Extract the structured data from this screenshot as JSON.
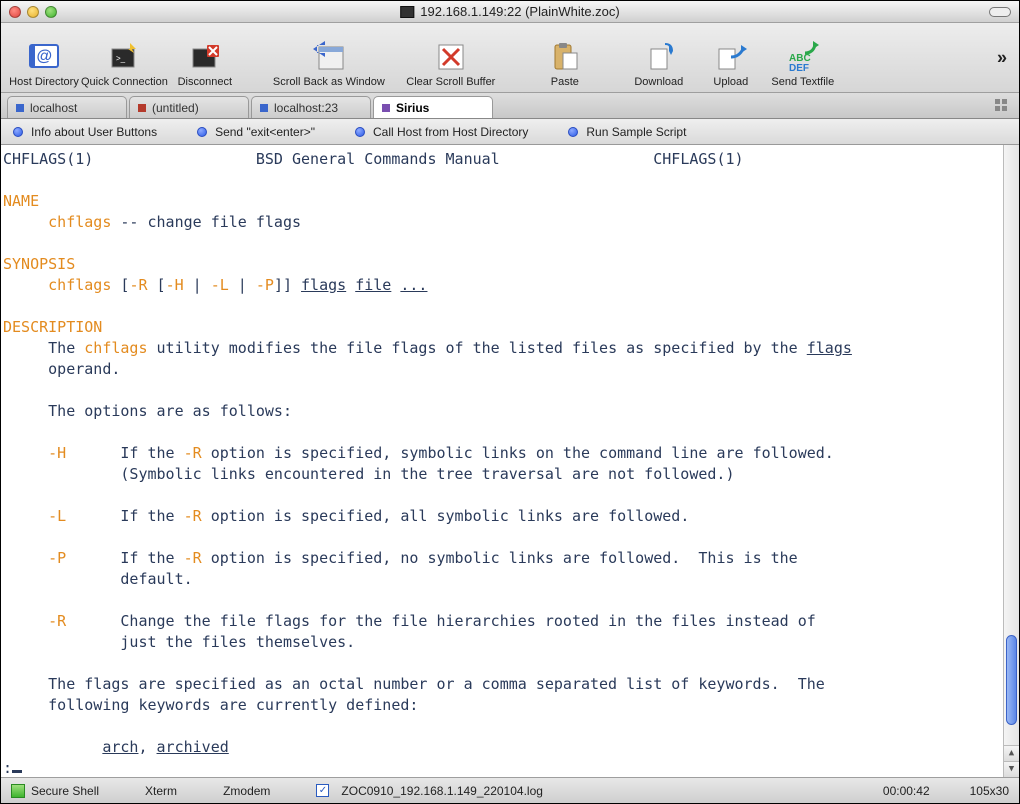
{
  "window": {
    "title": "192.168.1.149:22 (PlainWhite.zoc)"
  },
  "toolbar": [
    {
      "label": "Host Directory"
    },
    {
      "label": "Quick Connection"
    },
    {
      "label": "Disconnect"
    },
    {
      "label": "Scroll Back as Window"
    },
    {
      "label": "Clear Scroll Buffer"
    },
    {
      "label": "Paste"
    },
    {
      "label": "Download"
    },
    {
      "label": "Upload"
    },
    {
      "label": "Send Textfile"
    }
  ],
  "tabs": [
    {
      "label": "localhost",
      "color": "blue",
      "active": false
    },
    {
      "label": "(untitled)",
      "color": "red",
      "active": false
    },
    {
      "label": "localhost:23",
      "color": "blue",
      "active": false
    },
    {
      "label": "Sirius",
      "color": "purple",
      "active": true
    }
  ],
  "userButtons": [
    {
      "label": "Info about User Buttons"
    },
    {
      "label": "Send \"exit<enter>\""
    },
    {
      "label": "Call Host from Host Directory"
    },
    {
      "label": "Run Sample Script"
    }
  ],
  "terminal": {
    "header_left": "CHFLAGS(1)",
    "header_center": "BSD General Commands Manual",
    "header_right": "CHFLAGS(1)",
    "name_hdr": "NAME",
    "name_cmd": "chflags",
    "name_desc": " -- change file flags",
    "syn_hdr": "SYNOPSIS",
    "syn_cmd": "chflags",
    "syn_b1": " [",
    "syn_R": "-R",
    "syn_b2": " [",
    "syn_H": "-H",
    "syn_pipe1": " | ",
    "syn_L": "-L",
    "syn_pipe2": " | ",
    "syn_P": "-P",
    "syn_b3": "]] ",
    "syn_flags": "flags",
    "syn_sp": " ",
    "syn_file": "file",
    "syn_sp2": " ",
    "syn_dots": "...",
    "desc_hdr": "DESCRIPTION",
    "desc_pre": "     The ",
    "desc_cmd": "chflags",
    "desc_mid": " utility modifies the file flags of the listed files as specified by the ",
    "desc_flags": "flags",
    "desc_line2": "     operand.",
    "opts_intro": "     The options are as follows:",
    "optH_tag": "-H",
    "optH_pre": "      If the ",
    "optH_R": "-R",
    "optH_post": " option is specified, symbolic links on the command line are followed.",
    "optH_line2": "             (Symbolic links encountered in the tree traversal are not followed.)",
    "optL_tag": "-L",
    "optL_pre": "      If the ",
    "optL_R": "-R",
    "optL_post": " option is specified, all symbolic links are followed.",
    "optP_tag": "-P",
    "optP_pre": "      If the ",
    "optP_R": "-R",
    "optP_post": " option is specified, no symbolic links are followed.  This is the",
    "optP_line2": "             default.",
    "optR_tag": "-R",
    "optR_text": "      Change the file flags for the file hierarchies rooted in the files instead of",
    "optR_line2": "             just the files themselves.",
    "flags_intro1": "     The flags are specified as an octal number or a comma separated list of keywords.  The",
    "flags_intro2": "     following keywords are currently defined:",
    "kw_arch": "arch",
    "kw_sep": ", ",
    "kw_archived": "archived",
    "prompt": ":",
    "indent5": "     ",
    "indent11": "           "
  },
  "status": {
    "shell": "Secure Shell",
    "term": "Xterm",
    "proto": "Zmodem",
    "logfile": "ZOC0910_192.168.1.149_220104.log",
    "time": "00:00:42",
    "size": "105x30"
  }
}
